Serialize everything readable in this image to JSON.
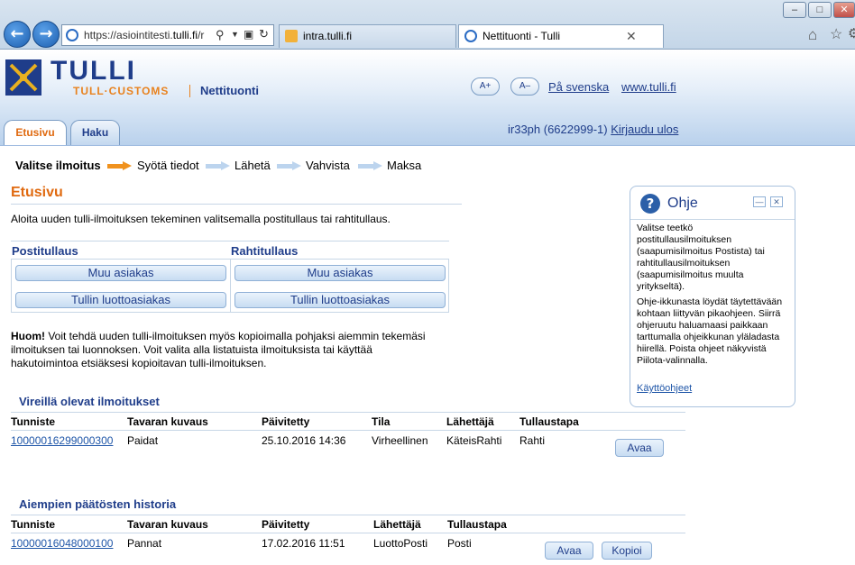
{
  "browser": {
    "url_prefix": "https://asiointitesti.",
    "url_domain": "tulli.fi",
    "url_suffix": "/r",
    "tabs": [
      {
        "label": "intra.tulli.fi"
      },
      {
        "label": "Nettituonti - Tulli"
      }
    ]
  },
  "header": {
    "logo_text": "TULLI",
    "logo_sub": "TULL·CUSTOMS",
    "service_name": "Nettituonti",
    "font_increase": "A+",
    "font_decrease": "A–",
    "swedish_link": "På svenska",
    "site_link": "www.tulli.fi",
    "tabs": [
      {
        "label": "Etusivu"
      },
      {
        "label": "Haku"
      }
    ],
    "user_id": "ir33ph (6622999-1)",
    "logout_label": "Kirjaudu ulos"
  },
  "steps": [
    {
      "label": "Valitse ilmoitus"
    },
    {
      "label": "Syötä tiedot"
    },
    {
      "label": "Lähetä"
    },
    {
      "label": "Vahvista"
    },
    {
      "label": "Maksa"
    }
  ],
  "main": {
    "title": "Etusivu",
    "intro": "Aloita uuden tulli-ilmoituksen tekeminen valitsemalla postitullaus tai rahtitullaus.",
    "postitullaus": {
      "heading": "Postitullaus",
      "buttons": [
        "Muu asiakas",
        "Tullin luottoasiakas"
      ]
    },
    "rahtitullaus": {
      "heading": "Rahtitullaus",
      "buttons": [
        "Muu asiakas",
        "Tullin luottoasiakas"
      ]
    },
    "notice_bold": "Huom!",
    "notice_line1": " Voit tehdä uuden tulli-ilmoituksen myös kopioimalla pohjaksi aiemmin tekemäsi",
    "notice_line2": "ilmoituksen tai luonnoksen. Voit valita alla listatuista ilmoituksista tai käyttää",
    "notice_line3": "hakutoimintoa etsiäksesi kopioitavan tulli-ilmoituksen."
  },
  "pending": {
    "heading": "Vireillä olevat ilmoitukset",
    "columns": [
      "Tunniste",
      "Tavaran kuvaus",
      "Päivitetty",
      "Tila",
      "Lähettäjä",
      "Tullaustapa"
    ],
    "rows": [
      {
        "id": "10000016299000300",
        "desc": "Paidat",
        "updated": "25.10.2016 14:36",
        "status": "Virheellinen",
        "sender": "KäteisRahti",
        "method": "Rahti",
        "open": "Avaa"
      }
    ]
  },
  "history": {
    "heading": "Aiempien päätösten historia",
    "columns": [
      "Tunniste",
      "Tavaran kuvaus",
      "Päivitetty",
      "Lähettäjä",
      "Tullaustapa"
    ],
    "rows": [
      {
        "id": "10000016048000100",
        "desc": "Pannat",
        "updated": "17.02.2016 11:51",
        "sender": "LuottoPosti",
        "method": "Posti",
        "open": "Avaa",
        "copy": "Kopioi"
      }
    ]
  },
  "help": {
    "title": "Ohje",
    "para1": "Valitse teetkö postitullausilmoituksen (saapumisilmoitus Postista) tai rahtitullausilmoituksen (saapumisilmoitus muulta yritykseltä).",
    "para2": "Ohje-ikkunasta löydät täytettävään kohtaan liittyvän pikaohjeen. Siirrä ohjeruutu haluamaasi paikkaan tarttumalla ohjeikkunan yläladasta hiirellä. Poista ohjeet näkyvistä Piilota-valinnalla.",
    "link": "Käyttöohjeet"
  },
  "colors": {
    "brand_blue": "#1f3d8a",
    "accent_orange": "#e8821e",
    "link_blue": "#1f56a8",
    "step_arrow_active": "#f0921e",
    "step_arrow_inactive": "#bcd4ee"
  }
}
